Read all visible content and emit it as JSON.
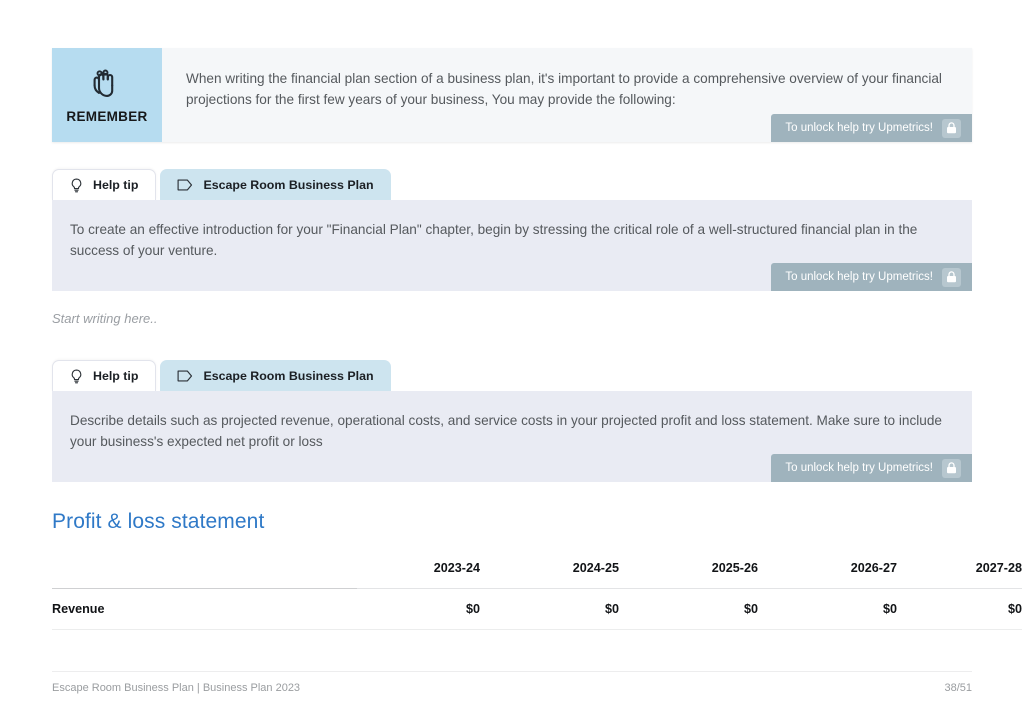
{
  "remember": {
    "label": "REMEMBER",
    "icon": "hand-string-reminder-icon",
    "body": "When writing the financial plan section of a business plan, it's important to provide a comprehensive overview of your financial projections for the first few years of your business, You may provide the following:",
    "unlock": {
      "text": "To unlock help try Upmetrics!",
      "icon": "lock-icon"
    }
  },
  "tip_one": {
    "tabs": [
      {
        "label": "Help tip",
        "icon": "lightbulb-icon",
        "active": false
      },
      {
        "label": "Escape Room Business Plan",
        "icon": "tag-icon",
        "active": true
      }
    ],
    "body": "To create an effective introduction for your \"Financial Plan\" chapter, begin by stressing the critical role of a well-structured financial plan in the success of your venture.",
    "unlock": {
      "text": "To unlock help try Upmetrics!",
      "icon": "lock-icon"
    }
  },
  "editor": {
    "placeholder": "Start writing here.."
  },
  "tip_two": {
    "tabs": [
      {
        "label": "Help tip",
        "icon": "lightbulb-icon",
        "active": false
      },
      {
        "label": "Escape Room Business Plan",
        "icon": "tag-icon",
        "active": true
      }
    ],
    "body": "Describe details such as projected revenue, operational costs, and service costs in your projected profit and loss statement. Make sure to include your business's expected net profit or loss",
    "unlock": {
      "text": "To unlock help try Upmetrics!",
      "icon": "lock-icon"
    }
  },
  "section": {
    "heading": "Profit & loss statement"
  },
  "table": {
    "columns": [
      "",
      "2023-24",
      "2024-25",
      "2025-26",
      "2026-27",
      "2027-28"
    ],
    "rows": [
      {
        "label": "Revenue",
        "values": [
          "$0",
          "$0",
          "$0",
          "$0",
          "$0"
        ]
      }
    ]
  },
  "footer": {
    "left": "Escape Room Business Plan | Business Plan 2023",
    "right": "38/51"
  },
  "colors": {
    "accent_blue": "#2f79c7",
    "badge_blue": "#b6dcf0",
    "tab_active": "#cde4ef",
    "tip_body": "#e9ebf3",
    "unlock_pill": "#9fb3bd"
  }
}
